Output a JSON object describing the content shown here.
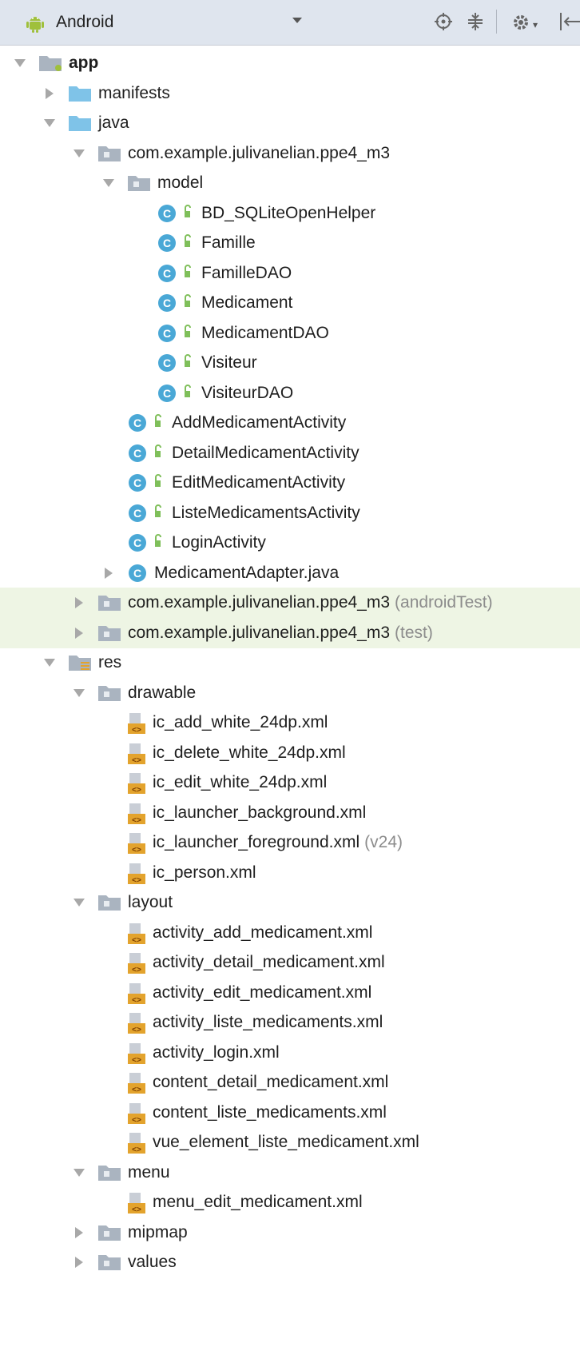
{
  "toolbar": {
    "title": "Android",
    "icons": [
      "android-icon",
      "dropdown-icon",
      "target-icon",
      "collapse-all-icon",
      "gear-icon",
      "hide-panel-icon"
    ]
  },
  "tree": [
    {
      "label": "app",
      "icon": "module-folder",
      "arrow": "down",
      "bold": true
    },
    {
      "label": "manifests",
      "icon": "folder",
      "arrow": "right"
    },
    {
      "label": "java",
      "icon": "folder",
      "arrow": "down"
    },
    {
      "label": "com.example.julivanelian.ppe4_m3",
      "icon": "package",
      "arrow": "down"
    },
    {
      "label": "model",
      "icon": "package",
      "arrow": "down"
    },
    {
      "label": "BD_SQLiteOpenHelper",
      "icon": "class"
    },
    {
      "label": "Famille",
      "icon": "class"
    },
    {
      "label": "FamilleDAO",
      "icon": "class"
    },
    {
      "label": "Medicament",
      "icon": "class"
    },
    {
      "label": "MedicamentDAO",
      "icon": "class"
    },
    {
      "label": "Visiteur",
      "icon": "class"
    },
    {
      "label": "VisiteurDAO",
      "icon": "class"
    },
    {
      "label": "AddMedicamentActivity",
      "icon": "class"
    },
    {
      "label": "DetailMedicamentActivity",
      "icon": "class"
    },
    {
      "label": "EditMedicamentActivity",
      "icon": "class"
    },
    {
      "label": "ListeMedicamentsActivity",
      "icon": "class"
    },
    {
      "label": "LoginActivity",
      "icon": "class"
    },
    {
      "label": "MedicamentAdapter.java",
      "icon": "class-file",
      "arrow": "right"
    },
    {
      "label": "com.example.julivanelian.ppe4_m3",
      "suffix": "(androidTest)",
      "icon": "package",
      "arrow": "right",
      "highlight": true
    },
    {
      "label": "com.example.julivanelian.ppe4_m3",
      "suffix": "(test)",
      "icon": "package",
      "arrow": "right",
      "highlight": true
    },
    {
      "label": "res",
      "icon": "res-folder",
      "arrow": "down"
    },
    {
      "label": "drawable",
      "icon": "package",
      "arrow": "down"
    },
    {
      "label": "ic_add_white_24dp.xml",
      "icon": "xml-file"
    },
    {
      "label": "ic_delete_white_24dp.xml",
      "icon": "xml-file"
    },
    {
      "label": "ic_edit_white_24dp.xml",
      "icon": "xml-file"
    },
    {
      "label": "ic_launcher_background.xml",
      "icon": "xml-file"
    },
    {
      "label": "ic_launcher_foreground.xml",
      "suffix": "(v24)",
      "icon": "xml-file"
    },
    {
      "label": "ic_person.xml",
      "icon": "xml-file"
    },
    {
      "label": "layout",
      "icon": "package",
      "arrow": "down"
    },
    {
      "label": "activity_add_medicament.xml",
      "icon": "xml-file"
    },
    {
      "label": "activity_detail_medicament.xml",
      "icon": "xml-file"
    },
    {
      "label": "activity_edit_medicament.xml",
      "icon": "xml-file"
    },
    {
      "label": "activity_liste_medicaments.xml",
      "icon": "xml-file"
    },
    {
      "label": "activity_login.xml",
      "icon": "xml-file"
    },
    {
      "label": "content_detail_medicament.xml",
      "icon": "xml-file"
    },
    {
      "label": "content_liste_medicaments.xml",
      "icon": "xml-file"
    },
    {
      "label": "vue_element_liste_medicament.xml",
      "icon": "xml-file"
    },
    {
      "label": "menu",
      "icon": "package",
      "arrow": "down"
    },
    {
      "label": "menu_edit_medicament.xml",
      "icon": "xml-file"
    },
    {
      "label": "mipmap",
      "icon": "package",
      "arrow": "right"
    },
    {
      "label": "values",
      "icon": "package",
      "arrow": "right"
    }
  ],
  "colors": {
    "toolbar_bg": "#dfe5ee",
    "highlight_bg": "#eef5e4",
    "android_green": "#9fc03b",
    "folder_blue": "#7fc3e8",
    "class_circle": "#4aa8d6",
    "xml_orange": "#e3a32d"
  }
}
